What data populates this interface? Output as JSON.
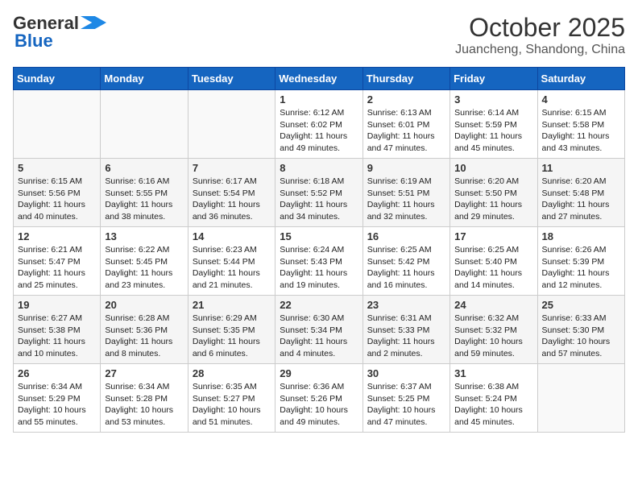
{
  "header": {
    "logo_general": "General",
    "logo_blue": "Blue",
    "month": "October 2025",
    "location": "Juancheng, Shandong, China"
  },
  "days_of_week": [
    "Sunday",
    "Monday",
    "Tuesday",
    "Wednesday",
    "Thursday",
    "Friday",
    "Saturday"
  ],
  "weeks": [
    [
      {
        "day": "",
        "text": ""
      },
      {
        "day": "",
        "text": ""
      },
      {
        "day": "",
        "text": ""
      },
      {
        "day": "1",
        "text": "Sunrise: 6:12 AM\nSunset: 6:02 PM\nDaylight: 11 hours and 49 minutes."
      },
      {
        "day": "2",
        "text": "Sunrise: 6:13 AM\nSunset: 6:01 PM\nDaylight: 11 hours and 47 minutes."
      },
      {
        "day": "3",
        "text": "Sunrise: 6:14 AM\nSunset: 5:59 PM\nDaylight: 11 hours and 45 minutes."
      },
      {
        "day": "4",
        "text": "Sunrise: 6:15 AM\nSunset: 5:58 PM\nDaylight: 11 hours and 43 minutes."
      }
    ],
    [
      {
        "day": "5",
        "text": "Sunrise: 6:15 AM\nSunset: 5:56 PM\nDaylight: 11 hours and 40 minutes."
      },
      {
        "day": "6",
        "text": "Sunrise: 6:16 AM\nSunset: 5:55 PM\nDaylight: 11 hours and 38 minutes."
      },
      {
        "day": "7",
        "text": "Sunrise: 6:17 AM\nSunset: 5:54 PM\nDaylight: 11 hours and 36 minutes."
      },
      {
        "day": "8",
        "text": "Sunrise: 6:18 AM\nSunset: 5:52 PM\nDaylight: 11 hours and 34 minutes."
      },
      {
        "day": "9",
        "text": "Sunrise: 6:19 AM\nSunset: 5:51 PM\nDaylight: 11 hours and 32 minutes."
      },
      {
        "day": "10",
        "text": "Sunrise: 6:20 AM\nSunset: 5:50 PM\nDaylight: 11 hours and 29 minutes."
      },
      {
        "day": "11",
        "text": "Sunrise: 6:20 AM\nSunset: 5:48 PM\nDaylight: 11 hours and 27 minutes."
      }
    ],
    [
      {
        "day": "12",
        "text": "Sunrise: 6:21 AM\nSunset: 5:47 PM\nDaylight: 11 hours and 25 minutes."
      },
      {
        "day": "13",
        "text": "Sunrise: 6:22 AM\nSunset: 5:45 PM\nDaylight: 11 hours and 23 minutes."
      },
      {
        "day": "14",
        "text": "Sunrise: 6:23 AM\nSunset: 5:44 PM\nDaylight: 11 hours and 21 minutes."
      },
      {
        "day": "15",
        "text": "Sunrise: 6:24 AM\nSunset: 5:43 PM\nDaylight: 11 hours and 19 minutes."
      },
      {
        "day": "16",
        "text": "Sunrise: 6:25 AM\nSunset: 5:42 PM\nDaylight: 11 hours and 16 minutes."
      },
      {
        "day": "17",
        "text": "Sunrise: 6:25 AM\nSunset: 5:40 PM\nDaylight: 11 hours and 14 minutes."
      },
      {
        "day": "18",
        "text": "Sunrise: 6:26 AM\nSunset: 5:39 PM\nDaylight: 11 hours and 12 minutes."
      }
    ],
    [
      {
        "day": "19",
        "text": "Sunrise: 6:27 AM\nSunset: 5:38 PM\nDaylight: 11 hours and 10 minutes."
      },
      {
        "day": "20",
        "text": "Sunrise: 6:28 AM\nSunset: 5:36 PM\nDaylight: 11 hours and 8 minutes."
      },
      {
        "day": "21",
        "text": "Sunrise: 6:29 AM\nSunset: 5:35 PM\nDaylight: 11 hours and 6 minutes."
      },
      {
        "day": "22",
        "text": "Sunrise: 6:30 AM\nSunset: 5:34 PM\nDaylight: 11 hours and 4 minutes."
      },
      {
        "day": "23",
        "text": "Sunrise: 6:31 AM\nSunset: 5:33 PM\nDaylight: 11 hours and 2 minutes."
      },
      {
        "day": "24",
        "text": "Sunrise: 6:32 AM\nSunset: 5:32 PM\nDaylight: 10 hours and 59 minutes."
      },
      {
        "day": "25",
        "text": "Sunrise: 6:33 AM\nSunset: 5:30 PM\nDaylight: 10 hours and 57 minutes."
      }
    ],
    [
      {
        "day": "26",
        "text": "Sunrise: 6:34 AM\nSunset: 5:29 PM\nDaylight: 10 hours and 55 minutes."
      },
      {
        "day": "27",
        "text": "Sunrise: 6:34 AM\nSunset: 5:28 PM\nDaylight: 10 hours and 53 minutes."
      },
      {
        "day": "28",
        "text": "Sunrise: 6:35 AM\nSunset: 5:27 PM\nDaylight: 10 hours and 51 minutes."
      },
      {
        "day": "29",
        "text": "Sunrise: 6:36 AM\nSunset: 5:26 PM\nDaylight: 10 hours and 49 minutes."
      },
      {
        "day": "30",
        "text": "Sunrise: 6:37 AM\nSunset: 5:25 PM\nDaylight: 10 hours and 47 minutes."
      },
      {
        "day": "31",
        "text": "Sunrise: 6:38 AM\nSunset: 5:24 PM\nDaylight: 10 hours and 45 minutes."
      },
      {
        "day": "",
        "text": ""
      }
    ]
  ]
}
